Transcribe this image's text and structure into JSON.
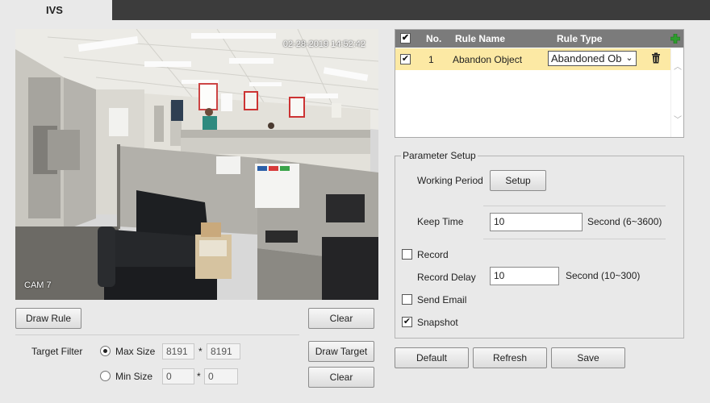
{
  "tabs": {
    "active": "IVS"
  },
  "video": {
    "timestamp": "02-28-2019 14:52:42",
    "camera_label": "CAM 7"
  },
  "left_controls": {
    "draw_rule": "Draw Rule",
    "clear_top": "Clear",
    "target_filter_label": "Target Filter",
    "max_size": {
      "label": "Max Size",
      "w": "8191",
      "sep": "*",
      "h": "8191"
    },
    "min_size": {
      "label": "Min Size",
      "w": "0",
      "sep": "*",
      "h": "0"
    },
    "draw_target": "Draw Target",
    "clear_bottom": "Clear"
  },
  "rule_table": {
    "headers": {
      "no": "No.",
      "name": "Rule Name",
      "type": "Rule Type"
    },
    "rows": [
      {
        "no": "1",
        "name": "Abandon Object",
        "type": "Abandoned Ob"
      }
    ]
  },
  "params": {
    "legend": "Parameter Setup",
    "working_period": "Working Period",
    "setup": "Setup",
    "keep_time": {
      "label": "Keep Time",
      "value": "10",
      "unit": "Second (6~3600)"
    },
    "record": "Record",
    "record_delay": {
      "label": "Record Delay",
      "value": "10",
      "unit": "Second (10~300)"
    },
    "send_email": "Send Email",
    "snapshot": "Snapshot"
  },
  "states": {
    "record": false,
    "send_email": false,
    "snapshot": true,
    "max_size_selected": true
  },
  "footer": {
    "default": "Default",
    "refresh": "Refresh",
    "save": "Save"
  },
  "icons": {
    "add": "plus-icon",
    "delete": "trash-icon",
    "dropdown": "chevron-down-icon",
    "scroll_up": "chevron-up-icon",
    "scroll_down": "chevron-down-icon"
  },
  "colors": {
    "selected_row": "#fce9a4",
    "header": "#7b7b7b",
    "add_icon": "#2e9d2e"
  }
}
